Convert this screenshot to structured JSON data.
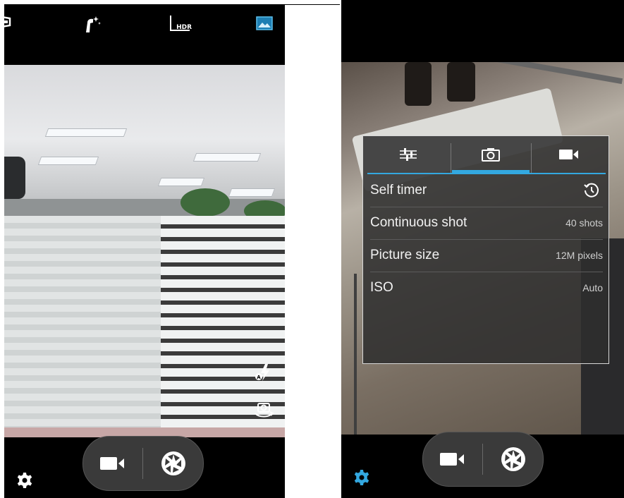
{
  "left_screen": {
    "top_bar": {
      "icons": [
        "panorama-icon",
        "effects-icon",
        "hdr-icon",
        "gallery-thumbnail-icon"
      ],
      "hdr_label": "HDR"
    },
    "side_icons": [
      "flash-auto-icon",
      "switch-camera-icon"
    ],
    "bottom_bar": {
      "icons": [
        "settings-gear-icon",
        "video-camera-icon",
        "shutter-icon"
      ]
    }
  },
  "right_screen": {
    "settings_panel": {
      "tabs": [
        {
          "icon": "sliders-icon"
        },
        {
          "icon": "camera-icon",
          "selected": true
        },
        {
          "icon": "video-camera-icon"
        }
      ],
      "rows": [
        {
          "label": "Self timer",
          "value": "",
          "icon": "timer-icon"
        },
        {
          "label": "Continuous shot",
          "value": "40 shots"
        },
        {
          "label": "Picture size",
          "value": "12M pixels"
        },
        {
          "label": "ISO",
          "value": "Auto"
        }
      ]
    },
    "bottom_bar": {
      "icons": [
        "settings-gear-icon",
        "video-camera-icon",
        "shutter-icon"
      ]
    }
  },
  "colors": {
    "accent": "#33a8e0",
    "panel_bg": "#2d2d2d",
    "bar_bg": "#000000"
  }
}
